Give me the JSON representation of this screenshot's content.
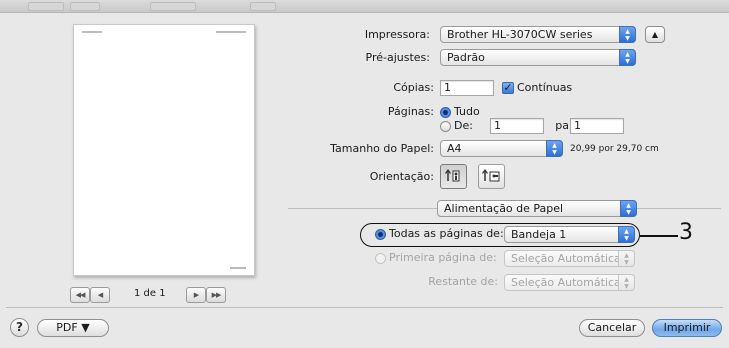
{
  "printer": {
    "label": "Impressora:",
    "value": "Brother HL-3070CW series"
  },
  "presets": {
    "label": "Pré-ajustes:",
    "value": "Padrão"
  },
  "copies": {
    "label": "Cópias:",
    "value": "1",
    "collated_label": "Contínuas"
  },
  "pages": {
    "label": "Páginas:",
    "all_label": "Tudo",
    "from_label": "De:",
    "from_value": "1",
    "to_label": "para:",
    "to_value": "1"
  },
  "paper_size": {
    "label": "Tamanho do Papel:",
    "value": "A4",
    "dimensions": "20,99 por 29,70 cm"
  },
  "orientation": {
    "label": "Orientação:"
  },
  "section_popup": {
    "value": "Alimentação de Papel"
  },
  "paper_feed": {
    "all_pages_label": "Todas as páginas de:",
    "all_pages_value": "Bandeja 1",
    "first_page_label": "Primeira página de:",
    "first_page_value": "Seleção Automática",
    "remaining_label": "Restante de:",
    "remaining_value": "Seleção Automática"
  },
  "preview": {
    "page_counter": "1 de 1"
  },
  "callout": {
    "number": "3"
  },
  "footer": {
    "help": "?",
    "pdf_label": "PDF ▼",
    "cancel_label": "Cancelar",
    "print_label": "Imprimir"
  },
  "colors": {
    "accent": "#3670d0",
    "dialog_bg": "#e8e8e8"
  }
}
